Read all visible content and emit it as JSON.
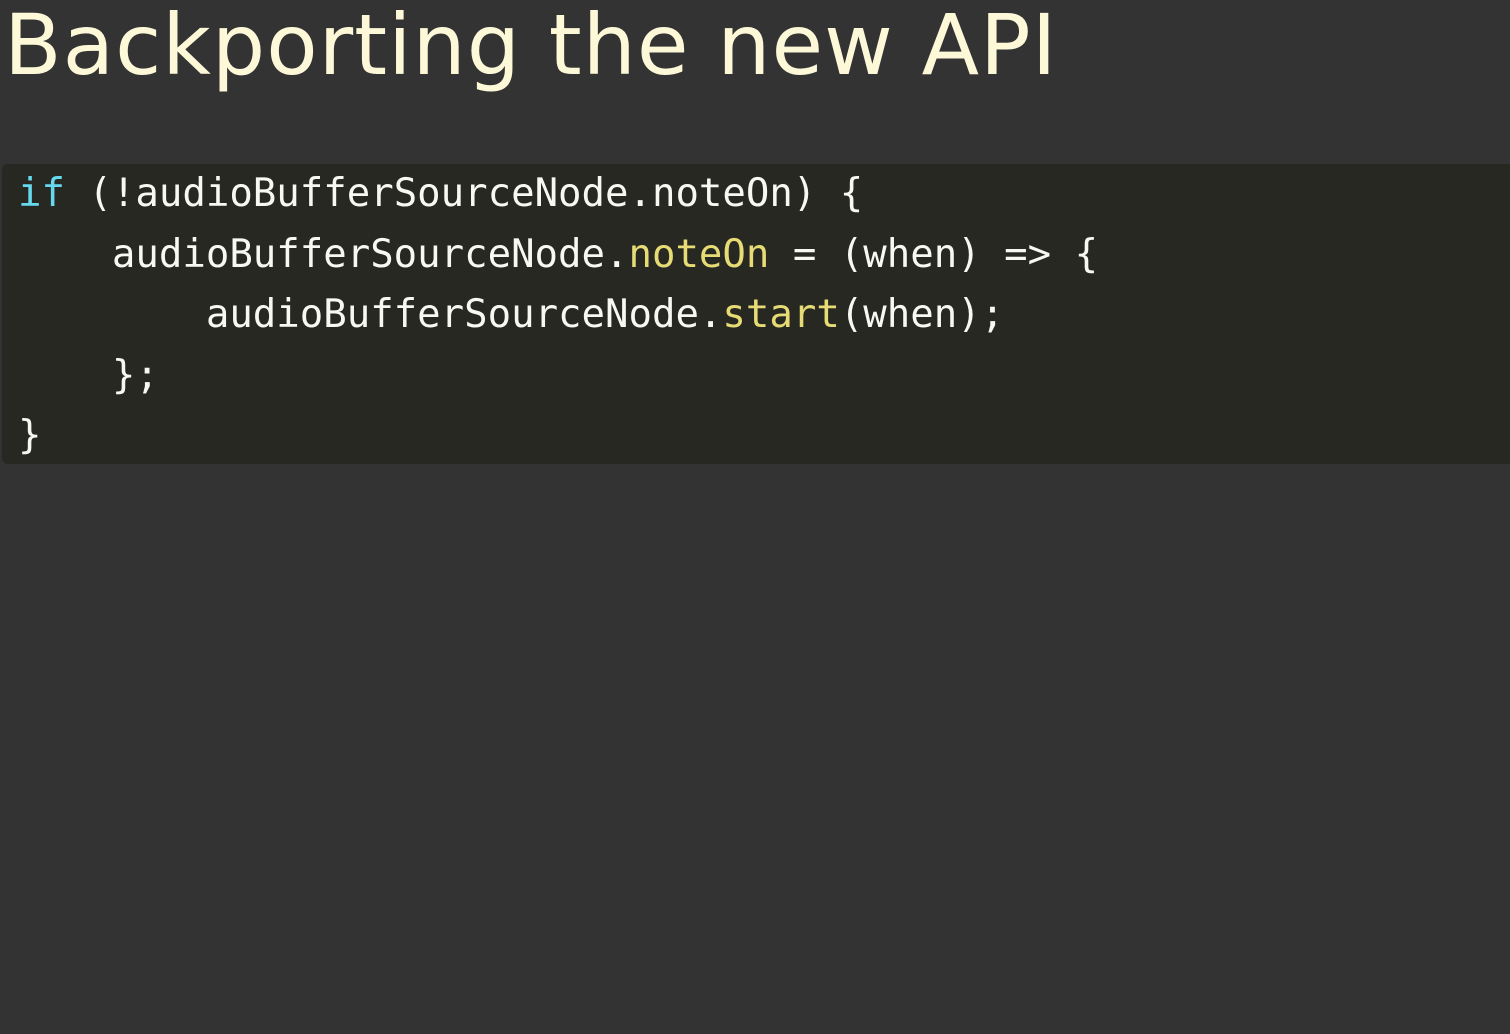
{
  "slide": {
    "title": "Backporting the new API"
  },
  "code": {
    "lines": [
      {
        "indent": "",
        "parts": [
          {
            "kind": "kw",
            "text": "if"
          },
          {
            "kind": "plain",
            "text": " (!audioBufferSourceNode.noteOn) {"
          }
        ]
      },
      {
        "indent": "    ",
        "parts": [
          {
            "kind": "plain",
            "text": "audioBufferSourceNode."
          },
          {
            "kind": "fn",
            "text": "noteOn"
          },
          {
            "kind": "plain",
            "text": " = (when) => {"
          }
        ]
      },
      {
        "indent": "        ",
        "parts": [
          {
            "kind": "plain",
            "text": "audioBufferSourceNode."
          },
          {
            "kind": "fn",
            "text": "start"
          },
          {
            "kind": "plain",
            "text": "(when);"
          }
        ]
      },
      {
        "indent": "    ",
        "parts": [
          {
            "kind": "plain",
            "text": "};"
          }
        ]
      },
      {
        "indent": "",
        "parts": [
          {
            "kind": "plain",
            "text": "}"
          }
        ]
      }
    ]
  },
  "colors": {
    "background": "#333333",
    "code_background": "#272822",
    "title": "#fdf8d8",
    "keyword": "#66d9ef",
    "function": "#e6db74",
    "plain": "#f8f8f2"
  }
}
